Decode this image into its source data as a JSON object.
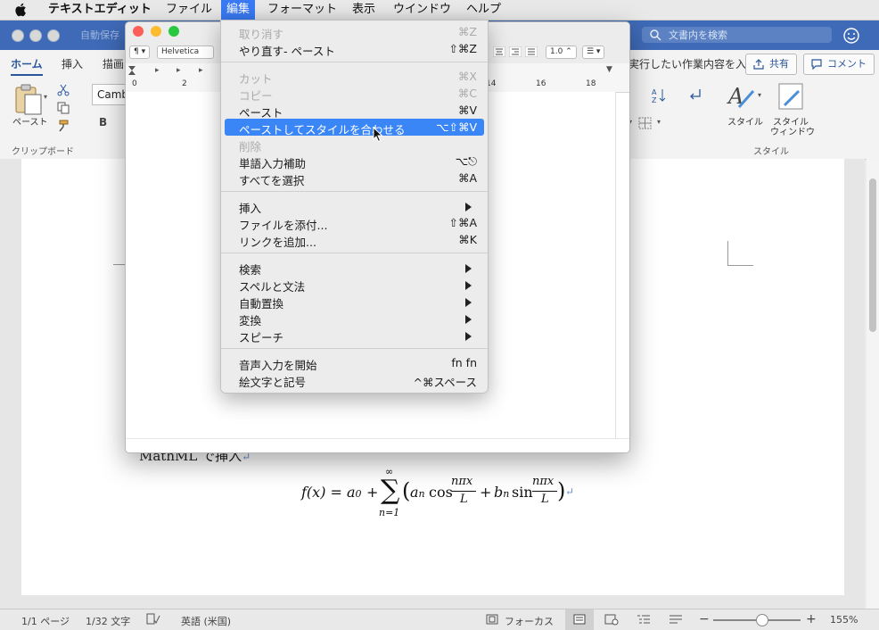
{
  "menubar": {
    "app_name": "テキストエディット",
    "items": [
      "ファイル",
      "編集",
      "フォーマット",
      "表示",
      "ウインドウ",
      "ヘルプ"
    ],
    "active": "編集"
  },
  "word": {
    "autosave": "自動保存",
    "search_placeholder": "文書内を検索",
    "tabs": [
      "ホーム",
      "挿入",
      "描画"
    ],
    "font_name": "Camb",
    "tell_me": "実行したい作業内容を入力します",
    "share_label": "共有",
    "comment_label": "コメント",
    "paste_label": "ペースト",
    "clipboard_group": "クリップボード",
    "styles_label": "スタイル",
    "styles_window_line1": "スタイル",
    "styles_window_line2": "ウィンドウ",
    "styles_group": "スタイル",
    "bold": "B",
    "doc": {
      "mathml_line": "MathML で挿入",
      "formula": {
        "lhs": "f(x) = a",
        "sub0": "0",
        "plus": "+",
        "sum_top": "∞",
        "sum_sym": "∑",
        "sum_bottom": "n=1",
        "paren_open": "(",
        "a": "a",
        "sub_n1": "n",
        "cos": "cos",
        "frac_num": "nπx",
        "frac_den": "L",
        "plus2": "+",
        "b": "b",
        "sub_n2": "n",
        "sin": "sin",
        "frac_num2": "nπx",
        "frac_den2": "L",
        "paren_close": ")"
      }
    },
    "status": {
      "page": "1/1 ページ",
      "words": "1/32 文字",
      "language": "英語 (米国)",
      "focus": "フォーカス",
      "zoom": "155%"
    }
  },
  "textedit": {
    "paragraph_style": "¶",
    "font": "Helvetica",
    "line_spacing": "1.0",
    "ruler_numbers": [
      "0",
      "2",
      "14",
      "16",
      "18"
    ]
  },
  "edit_menu": {
    "items": [
      {
        "label": "取り消す",
        "shortcut": "⌘Z",
        "disabled": true
      },
      {
        "label": "やり直す- ペースト",
        "shortcut": "⇧⌘Z",
        "disabled": false
      },
      {
        "label": "カット",
        "shortcut": "⌘X",
        "disabled": true
      },
      {
        "label": "コピー",
        "shortcut": "⌘C",
        "disabled": true
      },
      {
        "label": "ペースト",
        "shortcut": "⌘V",
        "disabled": false
      },
      {
        "label": "ペーストしてスタイルを合わせる",
        "shortcut": "⌥⇧⌘V",
        "disabled": false,
        "highlighted": true
      },
      {
        "label": "削除",
        "shortcut": "",
        "disabled": true
      },
      {
        "label": "単語入力補助",
        "shortcut": "⌥⎋",
        "disabled": false
      },
      {
        "label": "すべてを選択",
        "shortcut": "⌘A",
        "disabled": false
      },
      {
        "label": "挿入",
        "submenu": true
      },
      {
        "label": "ファイルを添付...",
        "shortcut": "⇧⌘A",
        "disabled": false
      },
      {
        "label": "リンクを追加...",
        "shortcut": "⌘K",
        "disabled": false
      },
      {
        "label": "検索",
        "submenu": true
      },
      {
        "label": "スペルと文法",
        "submenu": true
      },
      {
        "label": "自動置換",
        "submenu": true
      },
      {
        "label": "変換",
        "submenu": true
      },
      {
        "label": "スピーチ",
        "submenu": true
      },
      {
        "label": "音声入力を開始",
        "shortcut": "fn fn",
        "disabled": false
      },
      {
        "label": "絵文字と記号",
        "shortcut": "^⌘スペース",
        "disabled": false
      }
    ]
  },
  "colors": {
    "word_blue": "#3f6ab7",
    "menu_highlight": "#3a86f7",
    "menubar_active": "#3a7bf5"
  }
}
